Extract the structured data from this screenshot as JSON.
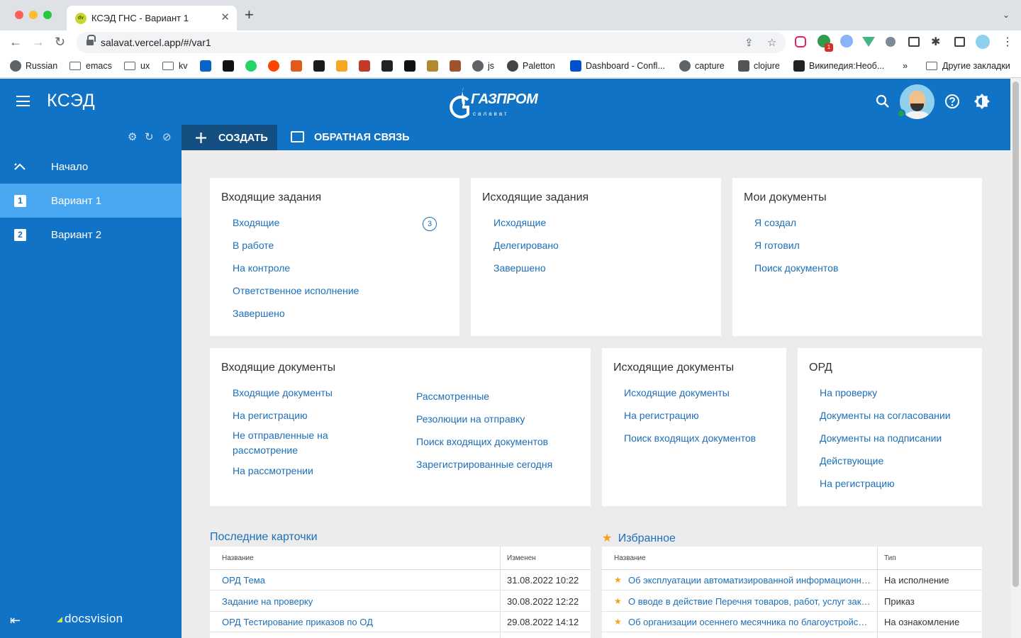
{
  "browser": {
    "tab_title": "КСЭД ГНС - Вариант 1",
    "tab_favicon_text": "dv",
    "url": "salavat.vercel.app/#/var1",
    "bookmarks": [
      {
        "label": "Russian",
        "icon": "globe",
        "color": "#5f6368"
      },
      {
        "label": "emacs",
        "icon": "folder"
      },
      {
        "label": "ux",
        "icon": "folder"
      },
      {
        "label": "kv",
        "icon": "folder"
      },
      {
        "label": "",
        "icon": "outlook",
        "color": "#0a64c8"
      },
      {
        "label": "",
        "icon": "c-app",
        "color": "#111111"
      },
      {
        "label": "",
        "icon": "whatsapp",
        "color": "#25d366"
      },
      {
        "label": "",
        "icon": "reddit",
        "color": "#ff4500"
      },
      {
        "label": "",
        "icon": "orange-app",
        "color": "#e25a1c"
      },
      {
        "label": "",
        "icon": "terminal",
        "color": "#1a1a1a"
      },
      {
        "label": "",
        "icon": "share",
        "color": "#f5a623"
      },
      {
        "label": "",
        "icon": "yii",
        "color": "#c0392b"
      },
      {
        "label": "",
        "icon": "m-app",
        "color": "#222222"
      },
      {
        "label": "",
        "icon": "flickr",
        "color": "#111111"
      },
      {
        "label": "",
        "icon": "bars",
        "color": "#b08a2e"
      },
      {
        "label": "",
        "icon": "dog",
        "color": "#a0522d"
      },
      {
        "label": "js",
        "icon": "globe",
        "color": "#5f6368"
      },
      {
        "label": "Paletton",
        "icon": "paletton",
        "color": "#444444"
      },
      {
        "label": "Dashboard - Confl...",
        "icon": "confluence",
        "color": "#0052cc"
      },
      {
        "label": "capture",
        "icon": "globe",
        "color": "#5f6368"
      },
      {
        "label": "clojure",
        "icon": "clojure",
        "color": "#555555"
      },
      {
        "label": "Википедия:Необ...",
        "icon": "wikipedia",
        "color": "#222222"
      }
    ],
    "bookmarks_overflow": "»",
    "other_bookmarks": "Другие закладки"
  },
  "header": {
    "app_title": "КСЭД",
    "logo_name": "ГАЗПРОМ",
    "logo_sub": "салават"
  },
  "sidebar": {
    "items": [
      {
        "label": "Начало",
        "badge": "",
        "active": false
      },
      {
        "label": "Вариант 1",
        "badge": "1",
        "active": true
      },
      {
        "label": "Вариант 2",
        "badge": "2",
        "active": false
      }
    ],
    "brand": "docsvision"
  },
  "commands": {
    "create": "СОЗДАТЬ",
    "feedback": "ОБРАТНАЯ СВЯЗЬ"
  },
  "cards": {
    "incoming_tasks": {
      "title": "Входящие задания",
      "links": [
        "Входящие",
        "В работе",
        "На контроле",
        "Ответственное исполнение",
        "Завершено"
      ],
      "incoming_count": "3"
    },
    "outgoing_tasks": {
      "title": "Исходящие задания",
      "links": [
        "Исходящие",
        "Делегировано",
        "Завершено"
      ]
    },
    "my_docs": {
      "title": "Мои документы",
      "links": [
        "Я создал",
        "Я готовил",
        "Поиск документов"
      ]
    },
    "incoming_docs": {
      "title": "Входящие документы",
      "links_left": [
        "Входящие документы",
        "На регистрацию",
        "Не отправленные на рассмотрение",
        "На рассмотрении"
      ],
      "links_right": [
        "Рассмотренные",
        "Резолюции на отправку",
        "Поиск входящих документов",
        "Зарегистрированные сегодня"
      ]
    },
    "outgoing_docs": {
      "title": "Исходящие документы",
      "links": [
        "Исходящие документы",
        "На регистрацию",
        "Поиск входящих документов"
      ]
    },
    "ord": {
      "title": "ОРД",
      "links": [
        "На проверку",
        "Документы на согласовании",
        "Документы на подписании",
        "Действующие",
        "На регистрацию"
      ]
    }
  },
  "recent": {
    "title": "Последние карточки",
    "col_name": "Название",
    "col_changed": "Изменен",
    "rows": [
      {
        "name": "ОРД Тема",
        "changed": "31.08.2022 10:22"
      },
      {
        "name": "Задание на проверку",
        "changed": "30.08.2022 12:22"
      },
      {
        "name": "ОРД Тестирование приказов по ОД",
        "changed": "29.08.2022 14:12"
      }
    ]
  },
  "favorites": {
    "title": "Избранное",
    "col_name": "Название",
    "col_type": "Тип",
    "rows": [
      {
        "name": "Об эксплуатации автоматизированной информационной системы",
        "type": "На исполнение"
      },
      {
        "name": "О вводе в действие Перечня товаров, работ, услуг закупок",
        "type": "Приказ"
      },
      {
        "name": "Об организации осеннего месячника по благоустройству",
        "type": "На ознакомление"
      }
    ]
  },
  "colors": {
    "brand_blue": "#1173c5",
    "active_item": "#4aa7f1",
    "create_button": "#154f82",
    "link": "#1d6fb8",
    "star": "#f4a21a"
  }
}
